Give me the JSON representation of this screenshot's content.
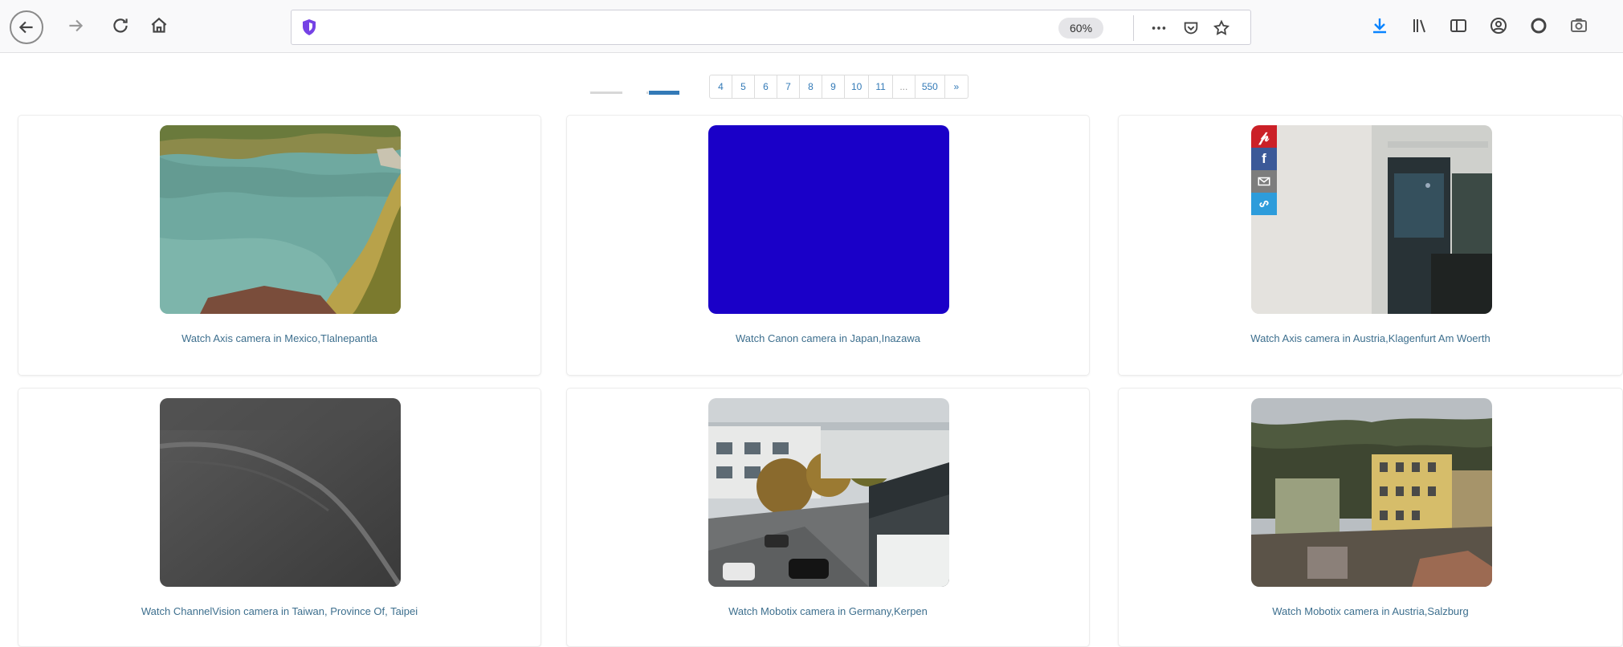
{
  "browser": {
    "url": "",
    "zoom": "60%",
    "icons": [
      "back-icon",
      "forward-icon",
      "reload-icon",
      "home-icon",
      "tracking-shield-icon",
      "more-icon",
      "pocket-icon",
      "bookmark-star-icon",
      "download-icon",
      "library-icon",
      "sidebar-icon",
      "account-icon",
      "extension-icon",
      "screenshot-icon"
    ]
  },
  "pagination": {
    "pages": [
      "4",
      "5",
      "6",
      "7",
      "8",
      "9",
      "10",
      "11",
      "...",
      "550",
      "»"
    ]
  },
  "cameras": [
    {
      "caption": "Watch Axis camera in Mexico,Tlalnepantla",
      "scene": "lake"
    },
    {
      "caption": "Watch Canon camera in Japan,Inazawa",
      "scene": "blue"
    },
    {
      "caption": "Watch Axis camera in Austria,Klagenfurt Am Woerth",
      "scene": "indoor"
    },
    {
      "caption": "Watch ChannelVision camera in Taiwan, Province Of, Taipei",
      "scene": "night"
    },
    {
      "caption": "Watch Mobotix camera in Germany,Kerpen",
      "scene": "street"
    },
    {
      "caption": "Watch Mobotix camera in Austria,Salzburg",
      "scene": "town"
    }
  ],
  "share": {
    "buttons": [
      "pinterest",
      "facebook",
      "email",
      "link"
    ],
    "colors": {
      "pinterest": "#cb2027",
      "facebook": "#3b5998",
      "email": "#7d7d7d",
      "link": "#2d9cdb"
    }
  },
  "colors": {
    "toolbar_bg": "#f9f9fa",
    "accent": "#0a84ff",
    "caption_link": "#3d6f8e",
    "blue_camera": "#1a00c8"
  }
}
